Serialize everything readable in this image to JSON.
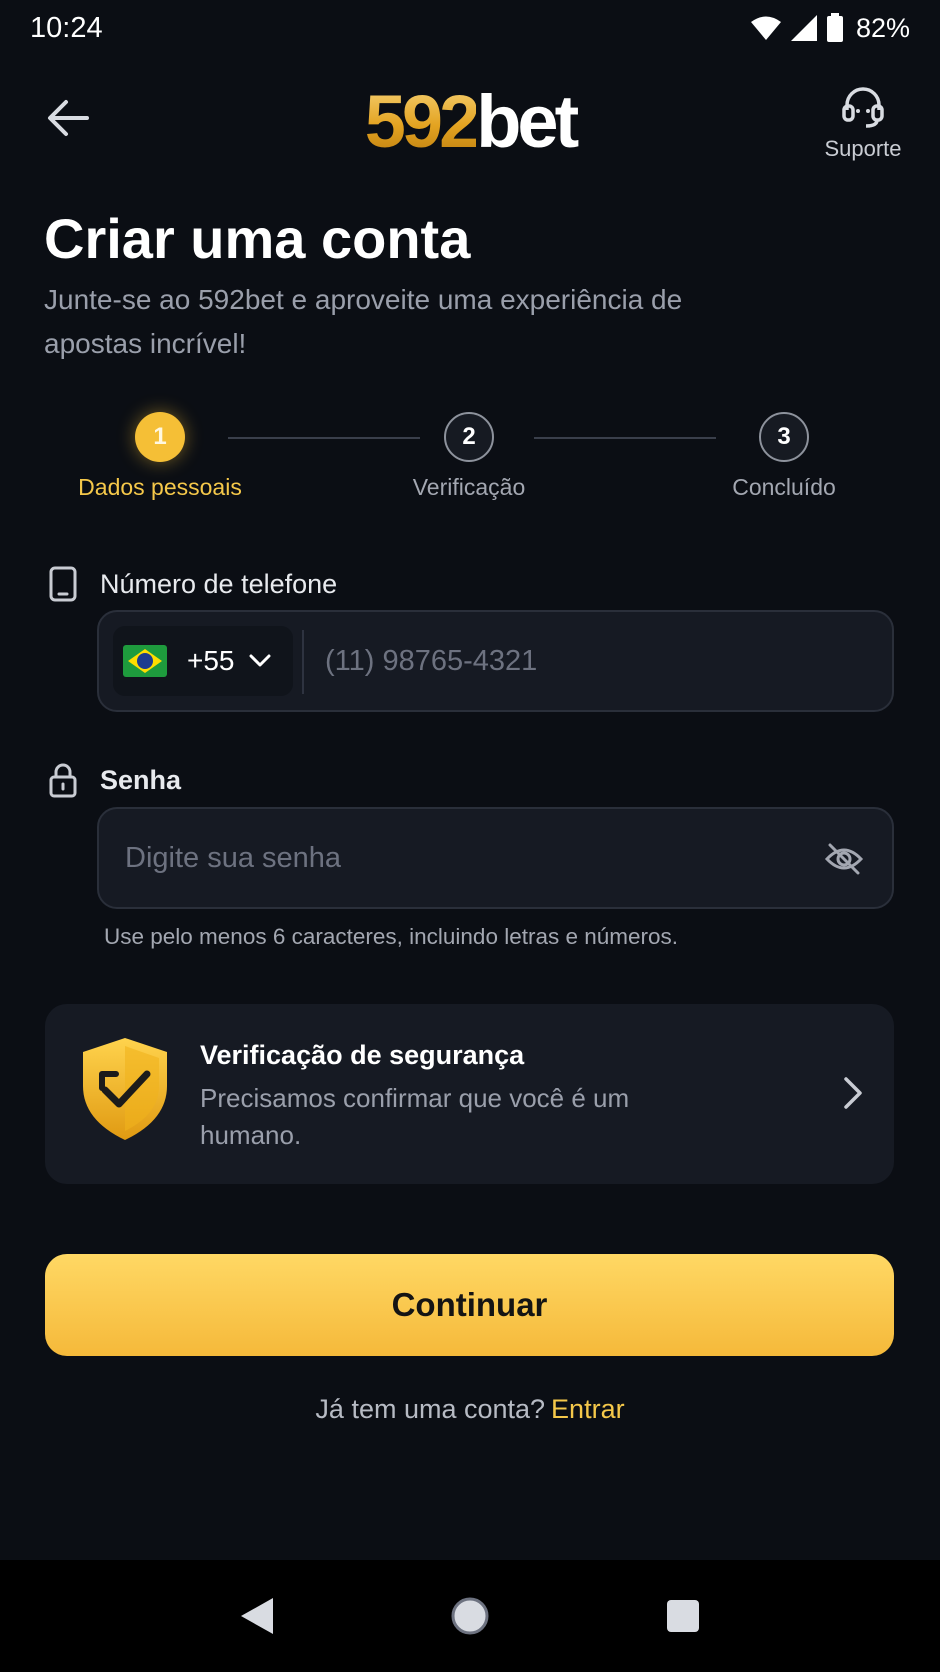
{
  "status_bar": {
    "time": "10:24",
    "battery": "82%",
    "icons": [
      "wifi-icon",
      "signal-icon",
      "battery-icon"
    ]
  },
  "header": {
    "logo_number": "592",
    "logo_word": "bet",
    "support_label": "Suporte",
    "icons": [
      "back-arrow-icon",
      "headset-icon"
    ]
  },
  "page": {
    "title": "Criar uma conta",
    "subtitle": "Junte-se ao 592bet e aproveite uma experiência de apostas incrível!"
  },
  "stepper": {
    "steps": [
      {
        "number": "1",
        "label": "Dados pessoais",
        "state": "active"
      },
      {
        "number": "2",
        "label": "Verificação",
        "state": "inactive"
      },
      {
        "number": "3",
        "label": "Concluído",
        "state": "inactive"
      }
    ]
  },
  "phone": {
    "label": "Número de telefone",
    "country_code": "+55",
    "placeholder": "(11) 98765-4321",
    "value": ""
  },
  "password": {
    "label": "Senha",
    "placeholder": "Digite sua senha",
    "value": "",
    "hint": "Use pelo menos 6 caracteres, incluindo letras e números."
  },
  "security": {
    "title": "Verificação de segurança",
    "description": "Precisamos confirmar que você é um humano."
  },
  "actions": {
    "continue_label": "Continuar",
    "login_prompt": "Já tem uma conta?",
    "login_link": "Entrar"
  },
  "colors": {
    "background": "#0b0e14",
    "accent": "#f5c84a",
    "card": "#161a23"
  }
}
